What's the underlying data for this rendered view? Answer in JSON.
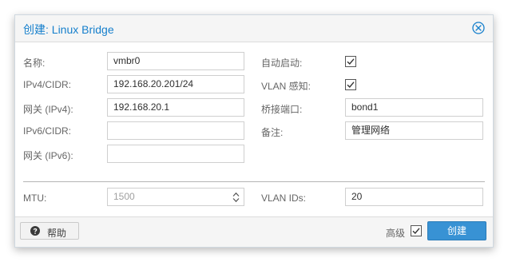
{
  "dialog": {
    "title": "创建: Linux Bridge"
  },
  "left": {
    "name_label": "名称:",
    "name_value": "vmbr0",
    "ipv4_label": "IPv4/CIDR:",
    "ipv4_value": "192.168.20.201/24",
    "gw4_label": "网关 (IPv4):",
    "gw4_value": "192.168.20.1",
    "ipv6_label": "IPv6/CIDR:",
    "ipv6_value": "",
    "gw6_label": "网关 (IPv6):",
    "gw6_value": "",
    "mtu_label": "MTU:",
    "mtu_placeholder": "1500"
  },
  "right": {
    "autostart_label": "自动启动:",
    "autostart_checked": true,
    "vlan_aware_label": "VLAN 感知:",
    "vlan_aware_checked": true,
    "bridge_ports_label": "桥接端口:",
    "bridge_ports_value": "bond1",
    "comment_label": "备注:",
    "comment_value": "管理网络",
    "vlan_ids_label": "VLAN IDs:",
    "vlan_ids_value": "20"
  },
  "footer": {
    "help_label": "帮助",
    "advanced_label": "高级",
    "advanced_checked": true,
    "create_label": "创建"
  },
  "colors": {
    "accent": "#157fcc",
    "button_primary": "#3892d4"
  },
  "icons": {
    "close": "close-circle-icon",
    "help": "question-circle-icon",
    "check": "checkmark-icon",
    "spinner": "up-down-spinner-icon"
  }
}
